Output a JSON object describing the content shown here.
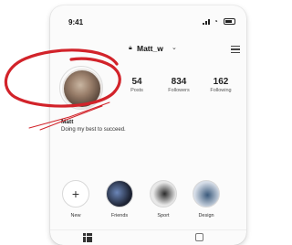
{
  "status_bar": {
    "time": "9:41"
  },
  "header": {
    "username": "Matt_w"
  },
  "stats": [
    {
      "value": "54",
      "label": "Posts"
    },
    {
      "value": "834",
      "label": "Followers"
    },
    {
      "value": "162",
      "label": "Following"
    }
  ],
  "profile": {
    "name": "Matt",
    "bio": "Doing my best to succeed."
  },
  "highlights": [
    {
      "label": "New"
    },
    {
      "label": "Friends"
    },
    {
      "label": "Sport"
    },
    {
      "label": "Design"
    }
  ],
  "colors": {
    "annotation_red": "#d2232a"
  }
}
